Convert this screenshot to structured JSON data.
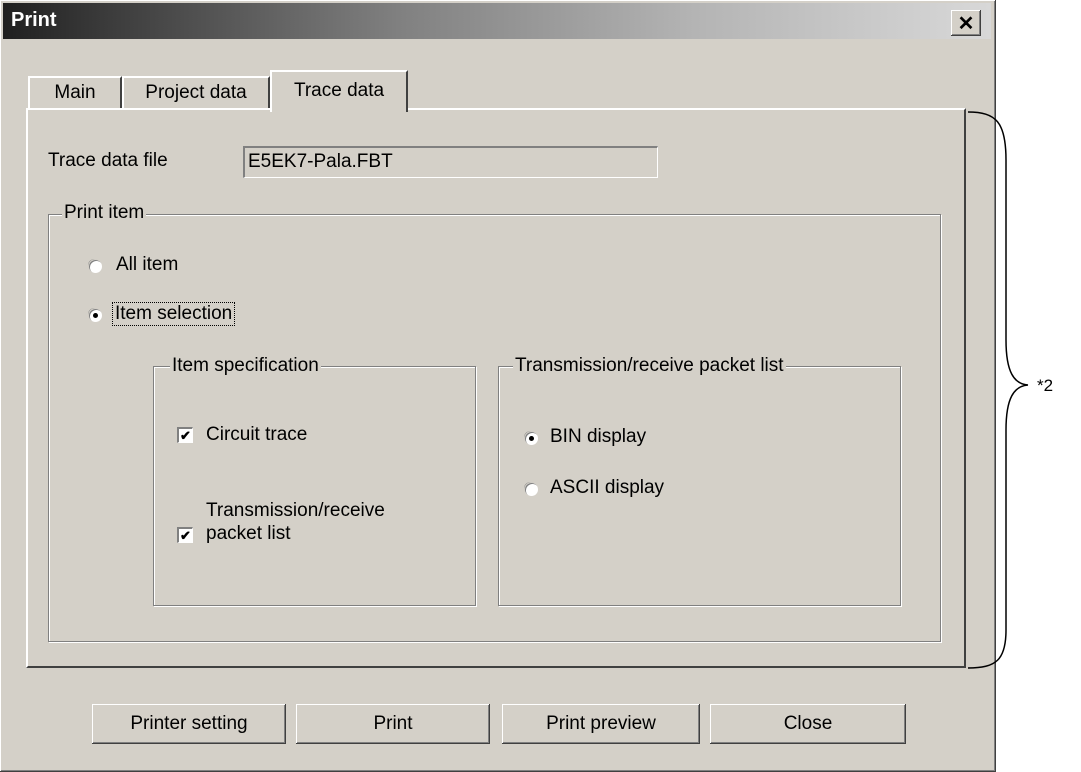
{
  "window": {
    "title": "Print",
    "close_glyph": "✕"
  },
  "tabs": [
    {
      "label": "Main",
      "active": false
    },
    {
      "label": "Project data",
      "active": false
    },
    {
      "label": "Trace data",
      "active": true
    }
  ],
  "trace_file": {
    "label": "Trace data file",
    "value": "E5EK7-Pala.FBT"
  },
  "print_item": {
    "legend": "Print item",
    "all_item": {
      "label": "All item",
      "selected": false
    },
    "item_selection": {
      "label": "Item selection",
      "selected": true
    }
  },
  "item_spec": {
    "legend": "Item specification",
    "circuit_trace": {
      "label": "Circuit trace",
      "checked": true
    },
    "packet_list": {
      "label_line1": "Transmission/receive",
      "label_line2": "packet list",
      "checked": true
    }
  },
  "packet_list": {
    "legend": "Transmission/receive packet list",
    "bin_display": {
      "label": "BIN display",
      "selected": true
    },
    "ascii_display": {
      "label": "ASCII display",
      "selected": false
    }
  },
  "buttons": {
    "printer_setting": "Printer setting",
    "print": "Print",
    "print_preview": "Print preview",
    "close": "Close"
  },
  "annotation": {
    "label": "*2"
  },
  "check_glyph": "✔"
}
